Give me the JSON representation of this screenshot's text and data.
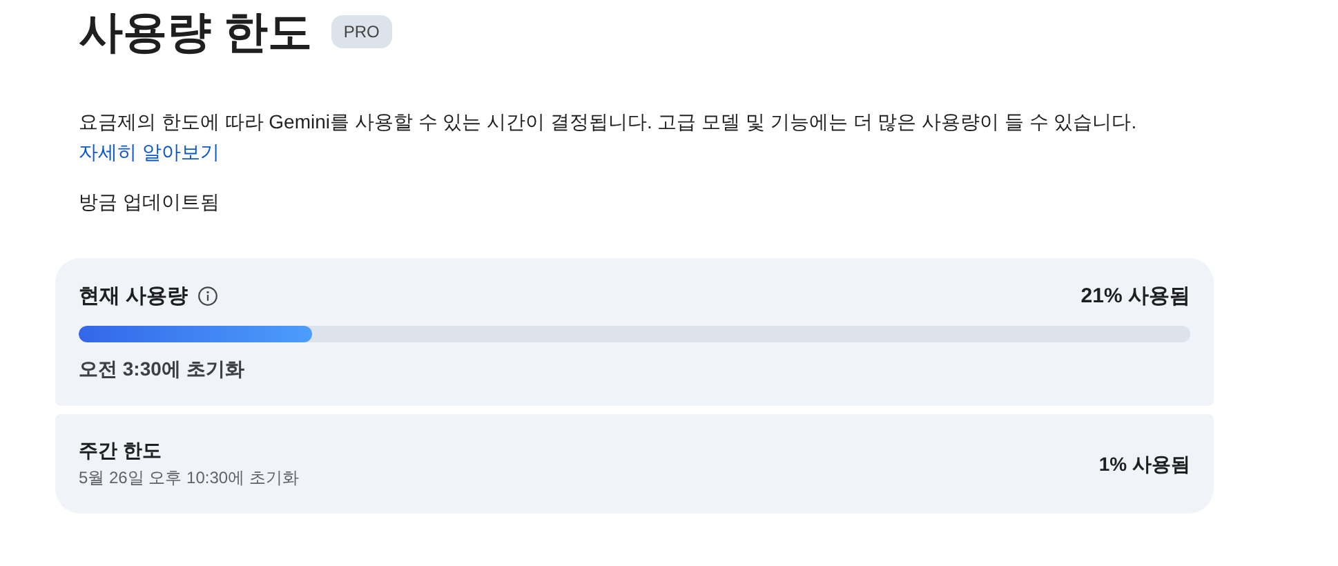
{
  "title": "사용량 한도",
  "badge": "PRO",
  "description": {
    "text": "요금제의 한도에 따라 Gemini를 사용할 수 있는 시간이 결정됩니다. 고급 모델 및 기능에는 더 많은 사용량이 들 수 있습니다.",
    "link": "자세히 알아보기"
  },
  "updated": "방금 업데이트됨",
  "limits": [
    {
      "kind": "meter",
      "title": "현재 사용량",
      "usage": "21% 사용됨",
      "level": 0.21,
      "reset": "오전 3:30에 초기화"
    },
    {
      "kind": "plain",
      "title": "주간 한도",
      "usage": "1% 사용됨",
      "reset": "5월 26일 오후 10:30에 초기화"
    }
  ]
}
